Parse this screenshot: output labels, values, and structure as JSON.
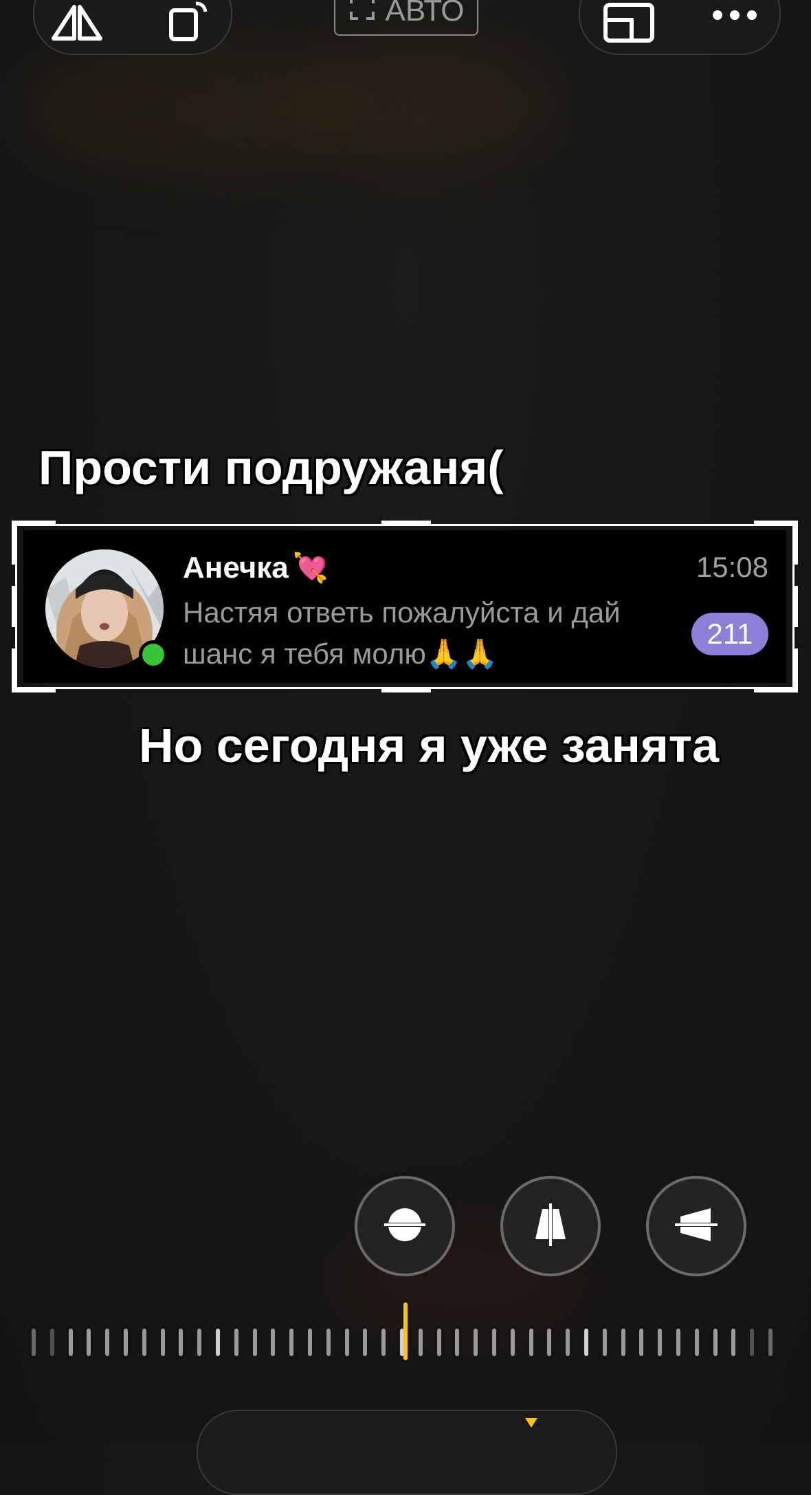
{
  "toolbar": {
    "auto_label": "АВТО",
    "icons": [
      "flip-icon",
      "rotate-icon",
      "crop-frame-icon",
      "aspect-ratio-icon",
      "more-icon"
    ]
  },
  "captions": {
    "top": "Прости подружаня(",
    "bottom": "Но сегодня я уже занята"
  },
  "chat": {
    "contact_name": "Анечка",
    "name_emoji": "💘",
    "time": "15:08",
    "message": "Настяя ответь пожалуйста и дай шанс я тебя молю🙏🙏",
    "unread_count": "211",
    "online": true
  },
  "controls": {
    "buttons": [
      "straighten-icon",
      "vertical-perspective-icon",
      "horizontal-perspective-icon"
    ],
    "accent_color": "#f5c518"
  },
  "colors": {
    "badge": "#8f7fd6",
    "online": "#3ac43a"
  }
}
